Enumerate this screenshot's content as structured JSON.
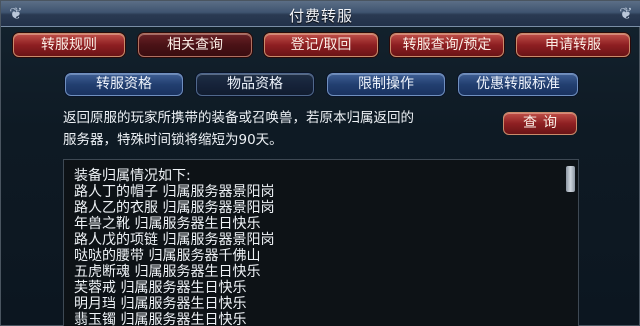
{
  "window": {
    "title": "付费转服"
  },
  "tabs": [
    {
      "label": "转服规则"
    },
    {
      "label": "相关查询"
    },
    {
      "label": "登记/取回"
    },
    {
      "label": "转服查询/预定"
    },
    {
      "label": "申请转服"
    }
  ],
  "subtabs": [
    {
      "label": "转服资格"
    },
    {
      "label": "物品资格"
    },
    {
      "label": "限制操作"
    },
    {
      "label": "优惠转服标准"
    }
  ],
  "info": {
    "line1": "返回原服的玩家所携带的装备或召唤兽，若原本归属返回的",
    "line2": "服务器，特殊时间锁将缩短为90天。"
  },
  "query_button": {
    "label": "查询"
  },
  "equipment_list": {
    "header": "装备归属情况如下:",
    "items": [
      "路人丁的帽子 归属服务器景阳岗",
      "路人乙的衣服 归属服务器景阳岗",
      "年兽之靴 归属服务器生日快乐",
      "路人戊的项链 归属服务器景阳岗",
      "哒哒的腰带 归属服务器千佛山",
      "五虎断魂 归属服务器生日快乐",
      "芙蓉戒 归属服务器生日快乐",
      "明月珰 归属服务器生日快乐",
      "翡玉镯 归属服务器生日快乐"
    ]
  },
  "colors": {
    "tab_red": "#8e1f22",
    "subtab_blue": "#223f70",
    "text": "#eef2f6"
  }
}
